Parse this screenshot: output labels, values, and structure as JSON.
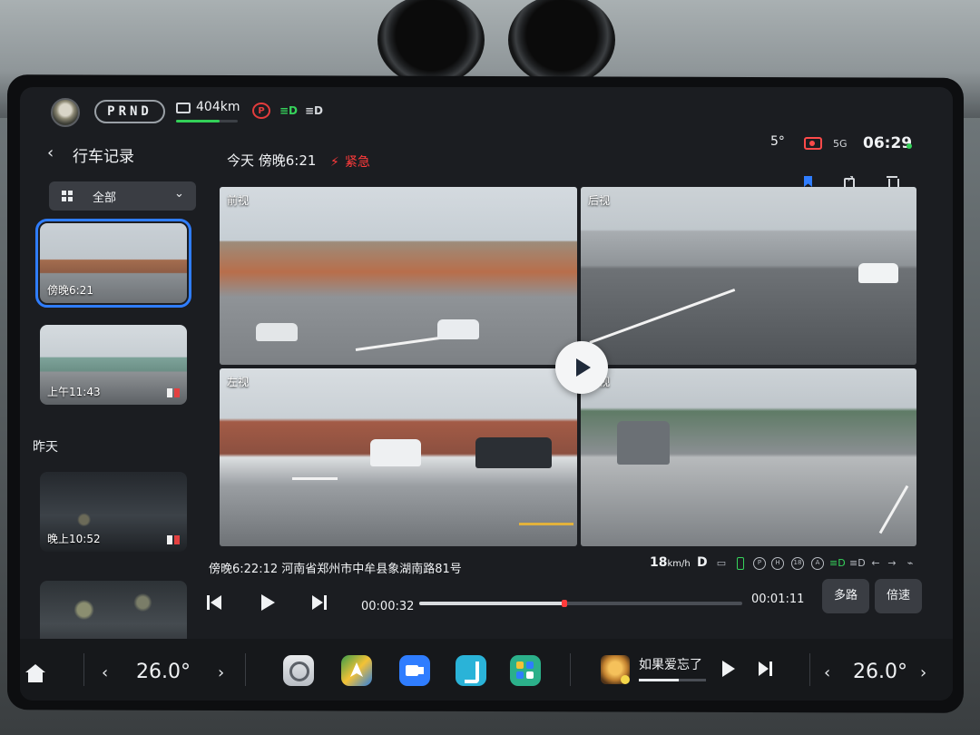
{
  "status_bar": {
    "gear": "PRND",
    "range": "404km",
    "range_fraction": 0.7,
    "indicator_park": "P",
    "indicator_green": "≡D",
    "indicator_white": "≡D",
    "outside_temp": "5°",
    "signal": "5G",
    "clock": "06:29"
  },
  "sidebar": {
    "title": "行车记录",
    "filter_label": "全部",
    "recordings": [
      {
        "label": "傍晚6:21",
        "selected": true
      },
      {
        "label": "上午11:43",
        "selected": false
      }
    ],
    "section_yesterday": "昨天",
    "recordings_yesterday": [
      {
        "label": "晚上10:52"
      },
      {
        "label": ""
      }
    ]
  },
  "header": {
    "title": "今天 傍晚6:21",
    "emergency_label": "紧急"
  },
  "cameras": {
    "front_label": "前视",
    "rear_label": "后视",
    "left_label": "左视",
    "right_label": "右视"
  },
  "info": {
    "timestamp_location": "傍晚6:22:12 河南省郑州市中牟县象湖南路81号",
    "speed_value": "18",
    "speed_unit": "km/h",
    "gear_state": "D"
  },
  "playback": {
    "current_time": "00:00:32",
    "total_time": "00:01:11",
    "progress": 0.45,
    "multi_label": "多路",
    "speed_label": "倍速"
  },
  "dock": {
    "temp_left": "26.0°",
    "temp_right": "26.0°",
    "song_title": "如果爱忘了",
    "song_progress": 0.6
  },
  "colors": {
    "accent": "#2f7dff",
    "emergency": "#ff3b3b",
    "ok_green": "#33d058"
  }
}
